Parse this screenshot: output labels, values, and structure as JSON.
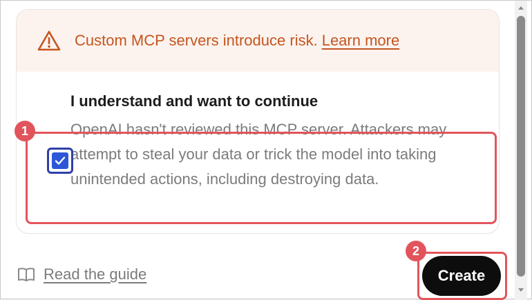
{
  "warning": {
    "message": "Custom MCP servers introduce risk.",
    "link_label": "Learn more",
    "icon": "warning-triangle-icon"
  },
  "consent": {
    "title": "I understand and want to continue",
    "body": "OpenAI hasn't reviewed this MCP server. Attackers may attempt to steal your data or trick the model into taking unintended actions, including destroying data.",
    "checked": true
  },
  "footer": {
    "guide_label": "Read the guide",
    "guide_icon": "book-icon",
    "create_label": "Create"
  },
  "annotations": {
    "checkbox_marker": "1",
    "create_marker": "2"
  },
  "colors": {
    "warning_text": "#c4551e",
    "warning_bg": "#fcf3ef",
    "checkbox": "#2c58d8",
    "annotation": "#e2545c",
    "primary_button": "#0d0d0d"
  }
}
